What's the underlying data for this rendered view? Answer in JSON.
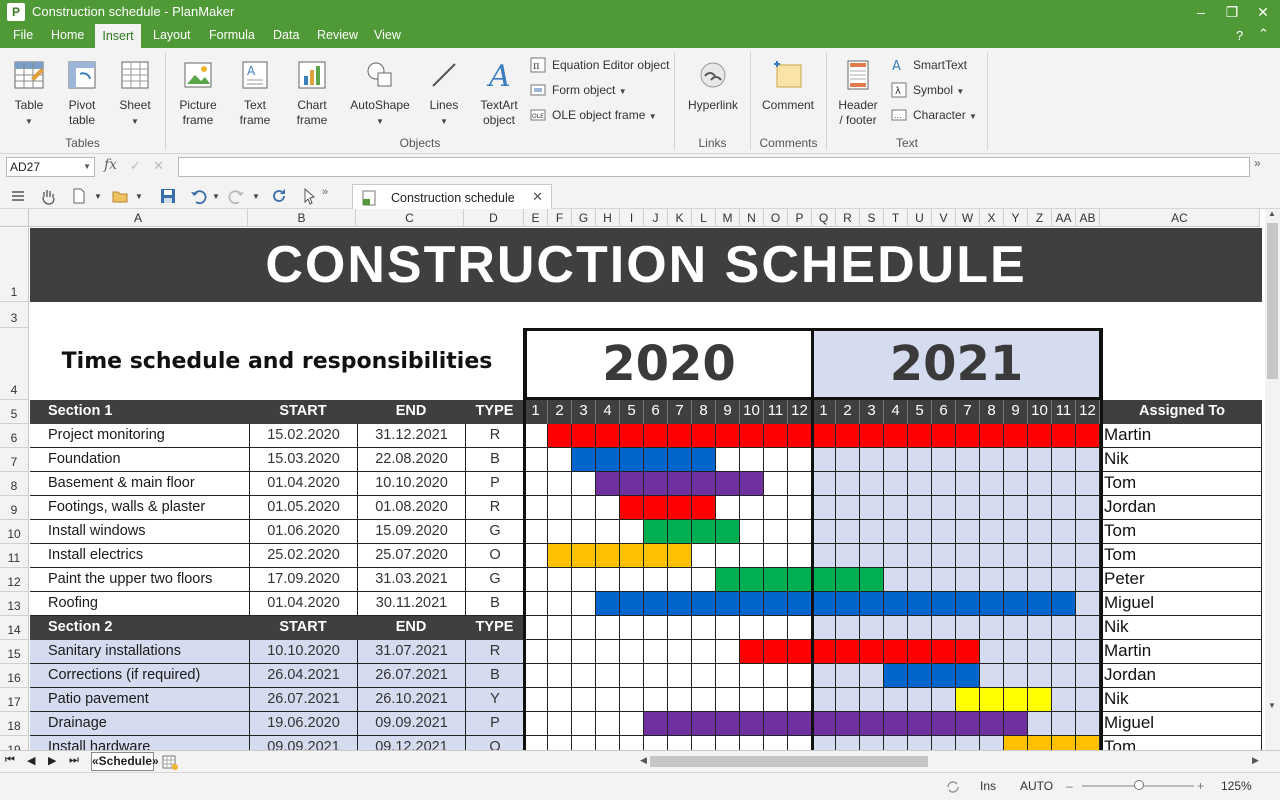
{
  "window": {
    "title": "Construction schedule - PlanMaker",
    "logo": "P"
  },
  "menu": {
    "items": [
      "File",
      "Home",
      "Insert",
      "Layout",
      "Formula",
      "Data",
      "Review",
      "View"
    ],
    "help": "?"
  },
  "ribbon": {
    "tables": {
      "label": "Tables",
      "table": "Table",
      "pivot": "Pivot\ntable",
      "sheet": "Sheet"
    },
    "objects": {
      "label": "Objects",
      "picture": "Picture\nframe",
      "text": "Text\nframe",
      "chart": "Chart\nframe",
      "autoshape": "AutoShape",
      "lines": "Lines",
      "textart": "TextArt\nobject",
      "equation": "Equation Editor object",
      "form": "Form object",
      "ole": "OLE object frame"
    },
    "links": {
      "label": "Links",
      "hyperlink": "Hyperlink"
    },
    "comments": {
      "label": "Comments",
      "comment": "Comment"
    },
    "text": {
      "label": "Text",
      "header": "Header\n/ footer",
      "smarttext": "SmartText",
      "symbol": "Symbol",
      "character": "Character"
    }
  },
  "formula": {
    "namebox": "AD27",
    "fx": "fx"
  },
  "doc_tab": {
    "label": "Construction schedule"
  },
  "columns": [
    "A",
    "B",
    "C",
    "D",
    "E",
    "F",
    "G",
    "H",
    "I",
    "J",
    "K",
    "L",
    "M",
    "N",
    "O",
    "P",
    "Q",
    "R",
    "S",
    "T",
    "U",
    "V",
    "W",
    "X",
    "Y",
    "Z",
    "AA",
    "AB",
    "AC"
  ],
  "rows": [
    "1",
    "3",
    "4",
    "5",
    "6",
    "7",
    "8",
    "9",
    "10",
    "11",
    "12",
    "13",
    "14",
    "15",
    "16",
    "17",
    "18",
    "19"
  ],
  "sheet": {
    "title": "CONSTRUCTION SCHEDULE",
    "subtitle": "Time schedule and responsibilities",
    "year1": "2020",
    "year2": "2021",
    "months": [
      "1",
      "2",
      "3",
      "4",
      "5",
      "6",
      "7",
      "8",
      "9",
      "10",
      "11",
      "12",
      "1",
      "2",
      "3",
      "4",
      "5",
      "6",
      "7",
      "8",
      "9",
      "10",
      "11",
      "12"
    ],
    "assigned_header": "Assigned To",
    "headers": [
      "START",
      "END",
      "TYPE"
    ],
    "section1": "Section 1",
    "section2": "Section 2",
    "tasks1": [
      {
        "name": "Project monitoring",
        "start": "15.02.2020",
        "end": "31.12.2021",
        "type": "R",
        "who": "Martin",
        "bar": [
          2,
          24
        ],
        "color": "#ff0000"
      },
      {
        "name": "Foundation",
        "start": "15.03.2020",
        "end": "22.08.2020",
        "type": "B",
        "who": "Nik",
        "bar": [
          3,
          8
        ],
        "color": "#0066cc"
      },
      {
        "name": "Basement & main floor",
        "start": "01.04.2020",
        "end": "10.10.2020",
        "type": "P",
        "who": "Tom",
        "bar": [
          4,
          10
        ],
        "color": "#7030a0"
      },
      {
        "name": "Footings, walls & plaster",
        "start": "01.05.2020",
        "end": "01.08.2020",
        "type": "R",
        "who": "Jordan",
        "bar": [
          5,
          8
        ],
        "color": "#ff0000"
      },
      {
        "name": "Install windows",
        "start": "01.06.2020",
        "end": "15.09.2020",
        "type": "G",
        "who": "Tom",
        "bar": [
          6,
          9
        ],
        "color": "#00b050"
      },
      {
        "name": "Install electrics",
        "start": "25.02.2020",
        "end": "25.07.2020",
        "type": "O",
        "who": "Tom",
        "bar": [
          2,
          7
        ],
        "color": "#ffc000"
      },
      {
        "name": "Paint the upper two floors",
        "start": "17.09.2020",
        "end": "31.03.2021",
        "type": "G",
        "who": "Peter",
        "bar": [
          9,
          15
        ],
        "color": "#00b050"
      },
      {
        "name": "Roofing",
        "start": "01.04.2020",
        "end": "30.11.2021",
        "type": "B",
        "who": "Miguel",
        "bar": [
          4,
          23
        ],
        "color": "#0066cc"
      }
    ],
    "section2_who": "Nik",
    "tasks2": [
      {
        "name": "Sanitary installations",
        "start": "10.10.2020",
        "end": "31.07.2021",
        "type": "R",
        "who": "Martin",
        "bar": [
          10,
          19
        ],
        "color": "#ff0000"
      },
      {
        "name": "Corrections (if required)",
        "start": "26.04.2021",
        "end": "26.07.2021",
        "type": "B",
        "who": "Jordan",
        "bar": [
          16,
          19
        ],
        "color": "#0066cc"
      },
      {
        "name": "Patio pavement",
        "start": "26.07.2021",
        "end": "26.10.2021",
        "type": "Y",
        "who": "Nik",
        "bar": [
          19,
          22
        ],
        "color": "#ffff00"
      },
      {
        "name": "Drainage",
        "start": "19.06.2020",
        "end": "09.09.2021",
        "type": "P",
        "who": "Miguel",
        "bar": [
          6,
          21
        ],
        "color": "#7030a0"
      },
      {
        "name": "Install hardware",
        "start": "09.09.2021",
        "end": "09.12.2021",
        "type": "O",
        "who": "Tom",
        "bar": [
          21,
          24
        ],
        "color": "#ffc000"
      }
    ]
  },
  "sheet_tabs": {
    "active": "«Schedule»"
  },
  "status": {
    "mode": "Ins",
    "calc": "AUTO",
    "zoom": "125%"
  },
  "colors": {
    "accent": "#4f9a37",
    "dark": "#3f3f3f",
    "year2021": "#d6dcef"
  }
}
